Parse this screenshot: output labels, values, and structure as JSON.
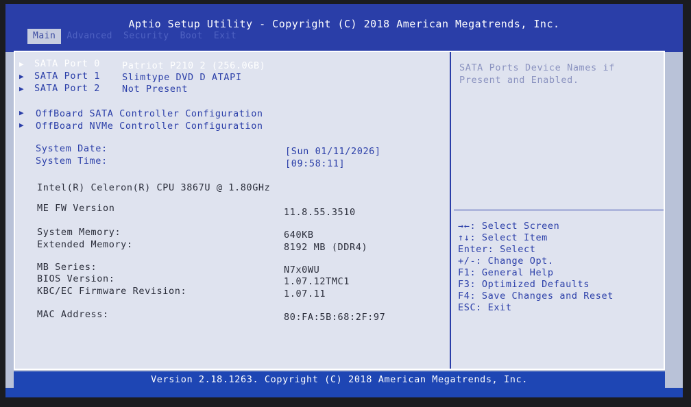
{
  "header": {
    "title": "Aptio Setup Utility - Copyright (C) 2018 American Megatrends, Inc.",
    "tabs": [
      "Main",
      "Advanced",
      "Security",
      "Boot",
      "Exit"
    ],
    "active_tab": "Main"
  },
  "sata": [
    {
      "label": "SATA Port 0",
      "value": "Patriot P210 2 (256.0GB)"
    },
    {
      "label": "SATA Port 1",
      "value": "Slimtype DVD D ATAPI"
    },
    {
      "label": "SATA Port 2",
      "value": "Not Present"
    }
  ],
  "submenus": [
    "OffBoard SATA Controller Configuration",
    "OffBoard NVMe Controller Configuration"
  ],
  "system": {
    "date_label": "System Date:",
    "date_value": "[Sun 01/11/2026]",
    "time_label": "System Time:",
    "time_value": "[09:58:11]"
  },
  "cpu": "Intel(R) Celeron(R) CPU 3867U @ 1.80GHz",
  "me_fw": {
    "label": "ME FW Version",
    "value": "11.8.55.3510"
  },
  "memory": {
    "system_label": "System Memory:",
    "system_value": "640KB",
    "extended_label": "Extended Memory:",
    "extended_value": "8192 MB (DDR4)"
  },
  "board": {
    "mb_label": "MB Series:",
    "mb_value": "N7x0WU",
    "bios_label": "BIOS Version:",
    "bios_value": "1.07.12TMC1",
    "kbc_label": "KBC/EC Firmware Revision:",
    "kbc_value": "1.07.11"
  },
  "mac": {
    "label": "MAC Address:",
    "value": "80:FA:5B:68:2F:97"
  },
  "help": {
    "line1": "SATA Ports Device Names if",
    "line2": "Present and Enabled."
  },
  "keys": [
    "→←: Select Screen",
    "↑↓: Select Item",
    "Enter: Select",
    "+/-: Change Opt.",
    "F1: General Help",
    "F3: Optimized Defaults",
    "F4: Save Changes and Reset",
    "ESC: Exit"
  ],
  "footer": "Version 2.18.1263. Copyright (C) 2018 American Megatrends, Inc."
}
